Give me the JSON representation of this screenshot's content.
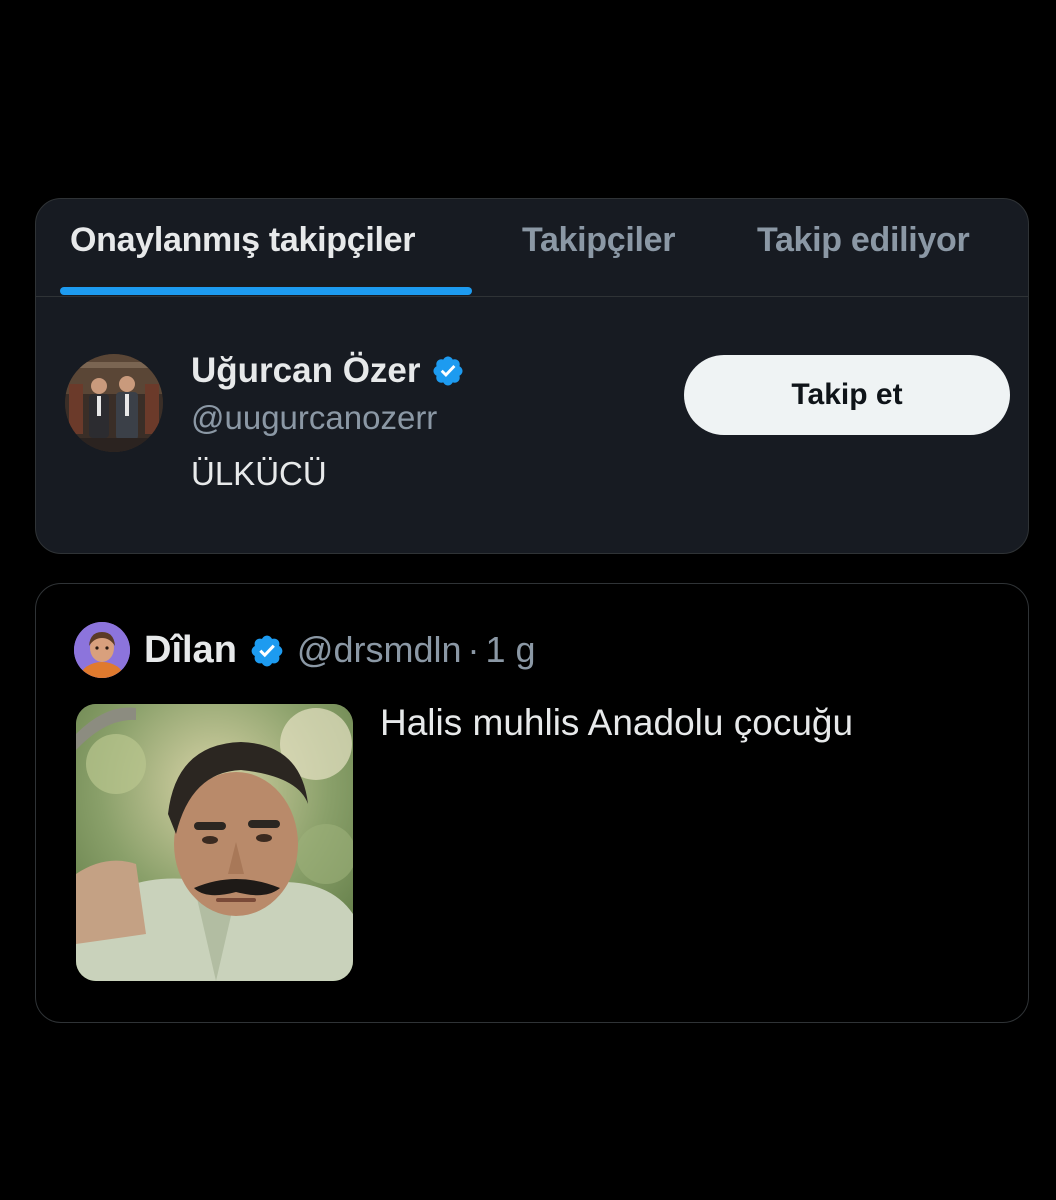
{
  "tabs": [
    {
      "label": "Onaylanmış takipçiler",
      "active": true
    },
    {
      "label": "Takipçiler",
      "active": false
    },
    {
      "label": "Takip ediliyor",
      "active": false
    }
  ],
  "user": {
    "name": "Uğurcan Özer",
    "handle": "@uugurcanozerr",
    "bio": "ÜLKÜCÜ",
    "follow_label": "Takip et",
    "verified_icon": "verified-badge-icon"
  },
  "tweet": {
    "author_name": "Dîlan",
    "author_handle": "@drsmdln",
    "separator": "·",
    "time": "1 g",
    "text": "Halis muhlis Anadolu çocuğu",
    "verified_icon": "verified-badge-icon"
  },
  "colors": {
    "accent": "#1d9bf0",
    "card_bg": "#171b22",
    "text_primary": "#e7e9ea",
    "text_secondary": "#8b98a5",
    "button_bg": "#eff3f4"
  }
}
